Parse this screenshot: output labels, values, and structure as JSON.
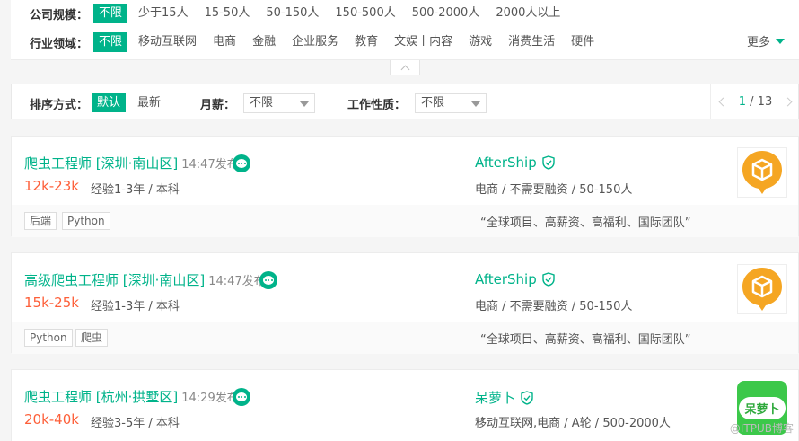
{
  "filters": {
    "company_size": {
      "label": "公司规模：",
      "options": [
        "不限",
        "少于15人",
        "15-50人",
        "50-150人",
        "150-500人",
        "500-2000人",
        "2000人以上"
      ]
    },
    "industry": {
      "label": "行业领域：",
      "options": [
        "不限",
        "移动互联网",
        "电商",
        "金融",
        "企业服务",
        "教育",
        "文娱丨内容",
        "游戏",
        "消费生活",
        "硬件"
      ]
    },
    "more_label": "更多"
  },
  "sort_bar": {
    "sort_label": "排序方式：",
    "sort_default": "默认",
    "sort_latest": "最新",
    "salary_label": "月薪：",
    "salary_value": "不限",
    "worktype_label": "工作性质：",
    "worktype_value": "不限",
    "page_current": "1",
    "page_total": "/ 13"
  },
  "jobs": [
    {
      "title": "爬虫工程师 [深圳·南山区]",
      "time": "14:47发布",
      "salary": "12k-23k",
      "requirement": "经验1-3年 / 本科",
      "company": "AfterShip",
      "company_info": "电商 / 不需要融资 / 50-150人",
      "tags": [
        "后端",
        "Python"
      ],
      "slogan": "“全球项目、高薪资、高福利、国际团队”"
    },
    {
      "title": "高级爬虫工程师 [深圳·南山区]",
      "time": "14:47发布",
      "salary": "15k-25k",
      "requirement": "经验1-3年 / 本科",
      "company": "AfterShip",
      "company_info": "电商 / 不需要融资 / 50-150人",
      "tags": [
        "Python",
        "爬虫"
      ],
      "slogan": "“全球项目、高薪资、高福利、国际团队”"
    },
    {
      "title": "爬虫工程师 [杭州·拱墅区]",
      "time": "14:29发布",
      "salary": "20k-40k",
      "requirement": "经验3-5年 / 本科",
      "company": "呆萝卜",
      "company_info": "移动互联网,电商 / A轮 / 500-2000人",
      "logo_text": "呆萝卜"
    }
  ],
  "colors": {
    "accent": "#00b38a",
    "salary": "#fd5f39",
    "logo_orange": "#f5a623",
    "logo_green": "#3cc84a"
  },
  "watermark": "@ITPUB博客"
}
